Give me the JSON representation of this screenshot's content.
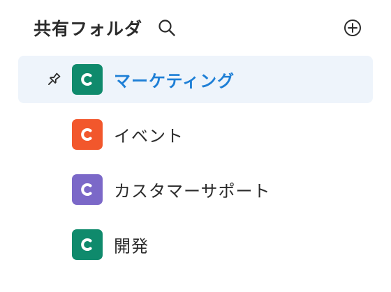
{
  "header": {
    "title": "共有フォルダ",
    "search_icon": "search-icon",
    "add_icon": "add-circle-icon"
  },
  "colors": {
    "active_text": "#1e7fd6",
    "active_bg": "#eef4fb",
    "green": "#0f8a6c",
    "orange": "#f2572c",
    "purple": "#7b68c8"
  },
  "folders": [
    {
      "label": "マーケティング",
      "color": "#0f8a6c",
      "active": true,
      "pinned": true,
      "icon": "folder-c-icon"
    },
    {
      "label": "イベント",
      "color": "#f2572c",
      "active": false,
      "pinned": false,
      "icon": "folder-c-icon"
    },
    {
      "label": "カスタマーサポート",
      "color": "#7b68c8",
      "active": false,
      "pinned": false,
      "icon": "folder-c-icon"
    },
    {
      "label": "開発",
      "color": "#0f8a6c",
      "active": false,
      "pinned": false,
      "icon": "folder-c-icon"
    }
  ]
}
